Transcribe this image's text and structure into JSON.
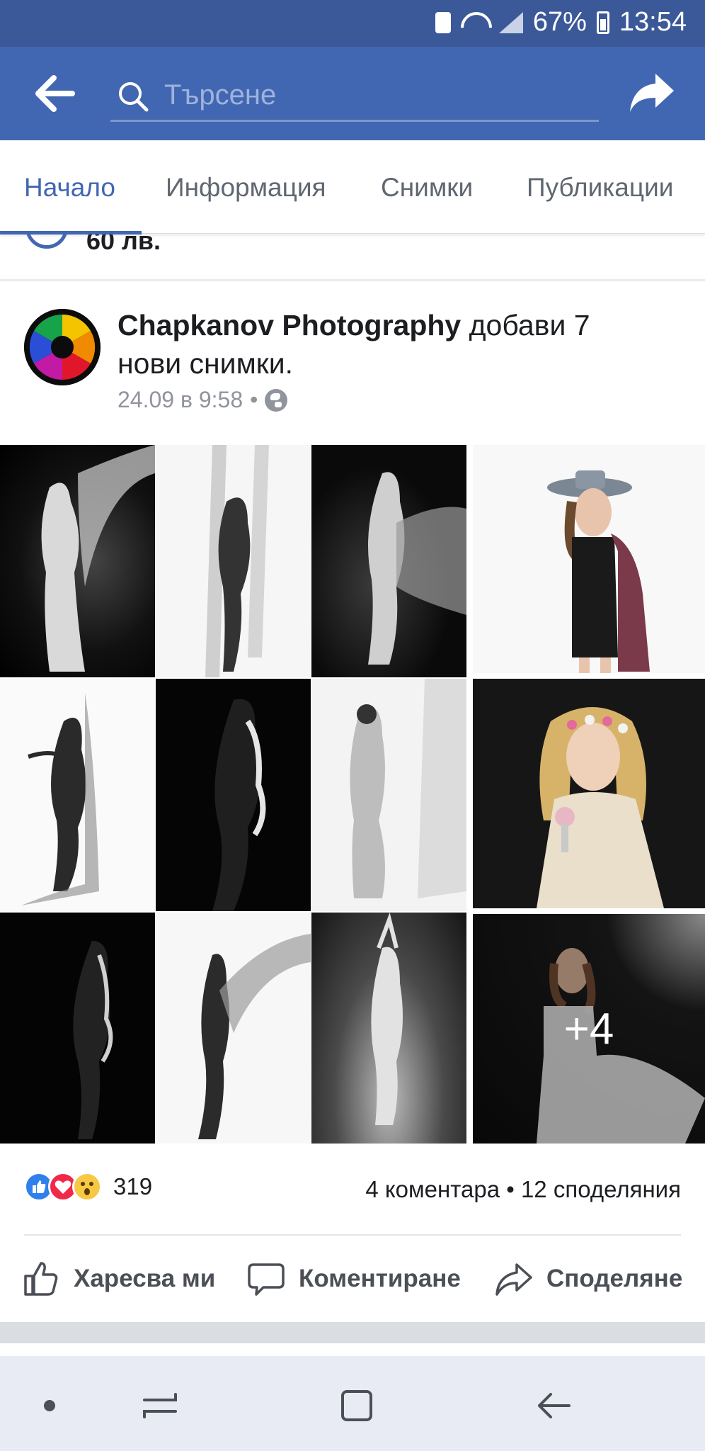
{
  "status_bar": {
    "battery": "67%",
    "time": "13:54"
  },
  "search": {
    "placeholder": "Търсене"
  },
  "tabs": [
    {
      "label": "Начало",
      "active": true
    },
    {
      "label": "Информация",
      "active": false
    },
    {
      "label": "Снимки",
      "active": false
    },
    {
      "label": "Публикации",
      "active": false
    }
  ],
  "previous_post": {
    "price": "60 лв."
  },
  "post": {
    "author": "Chapkanov Photography",
    "action_text": " добави 7 нови снимки.",
    "timestamp": "24.09 в 9:58",
    "more_photos": "+4"
  },
  "engagement": {
    "reaction_count": "319",
    "comments_shares": "4 коментара • 12 споделяния"
  },
  "actions": {
    "like": "Харесва ми",
    "comment": "Коментиране",
    "share": "Споделяне"
  },
  "colors": {
    "brand": "#4267b2",
    "status_bar": "#3b5998",
    "like": "#2f80ed",
    "love": "#f0284a",
    "wow": "#f7c844"
  }
}
